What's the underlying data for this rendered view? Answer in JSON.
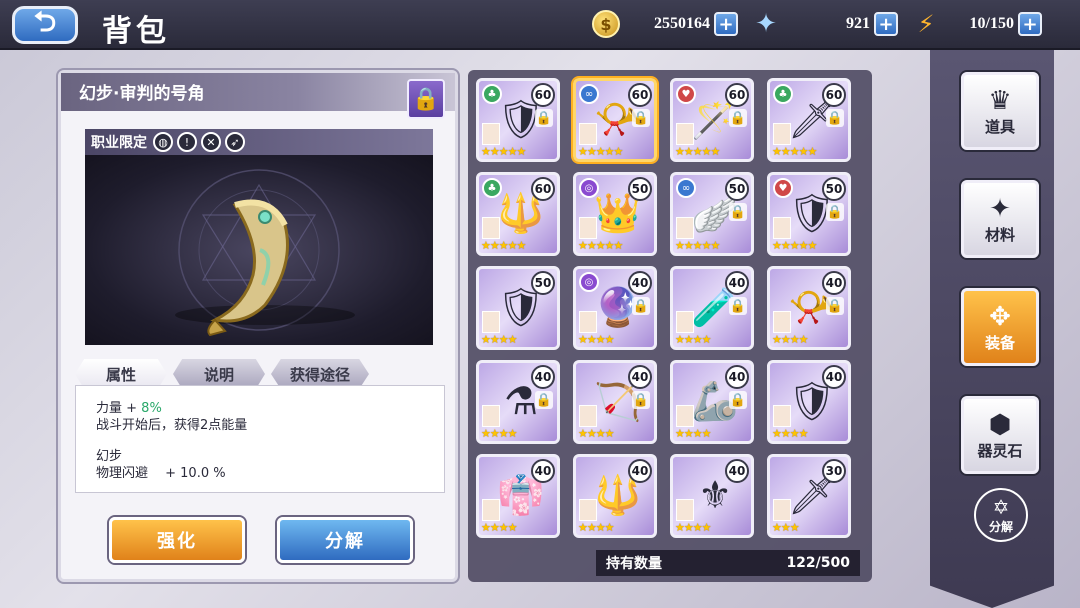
{
  "header": {
    "back_icon": "back-arrow-icon",
    "title": "背包",
    "gold": "2550164",
    "gems": "921",
    "stamina": "10/150"
  },
  "detail": {
    "item_name": "幻步·审判的号角",
    "class_restriction_label": "职业限定",
    "class_icons": [
      "shield-class-icon",
      "dagger-class-icon",
      "swords-class-icon",
      "bow-class-icon"
    ],
    "tabs": [
      "属性",
      "说明",
      "获得途径"
    ],
    "stat_line_1_prefix": "力量 + ",
    "stat_line_1_value": "8%",
    "stat_line_2": "战斗开始后，获得2点能量",
    "set_name": "幻步",
    "stat_line_3": "物理闪避 　+ 10.0 %",
    "enhance_label": "强化",
    "decompose_label": "分解"
  },
  "inventory": {
    "items": [
      {
        "level": "60",
        "stars": "★★★★★",
        "icon": "dark-armor-icon",
        "art": "🛡",
        "locked": true,
        "selected": false,
        "elem": "green"
      },
      {
        "level": "60",
        "stars": "★★★★★",
        "icon": "horn-icon",
        "art": "📯",
        "locked": true,
        "selected": true,
        "elem": "blue"
      },
      {
        "level": "60",
        "stars": "★★★★★",
        "icon": "staff-icon",
        "art": "🪄",
        "locked": true,
        "selected": false,
        "elem": "red"
      },
      {
        "level": "60",
        "stars": "★★★★★",
        "icon": "red-sword-icon",
        "art": "🗡",
        "locked": true,
        "selected": false,
        "elem": "green"
      },
      {
        "level": "60",
        "stars": "★★★★★",
        "icon": "scepter-icon",
        "art": "🔱",
        "locked": false,
        "selected": false,
        "elem": "green"
      },
      {
        "level": "50",
        "stars": "★★★★★",
        "icon": "crown-cushion-icon",
        "art": "👑",
        "locked": false,
        "selected": false,
        "elem": "purple"
      },
      {
        "level": "50",
        "stars": "★★★★★",
        "icon": "winged-boots-icon",
        "art": "🪽",
        "locked": true,
        "selected": false,
        "elem": "blue"
      },
      {
        "level": "50",
        "stars": "★★★★★",
        "icon": "round-shield-icon",
        "art": "🛡",
        "locked": true,
        "selected": false,
        "elem": "red"
      },
      {
        "level": "50",
        "stars": "★★★★",
        "icon": "knight-armor-icon",
        "art": "🛡",
        "locked": false,
        "selected": false,
        "elem": "none"
      },
      {
        "level": "40",
        "stars": "★★★★",
        "icon": "orb-staff-icon",
        "art": "🔮",
        "locked": true,
        "selected": false,
        "elem": "purple"
      },
      {
        "level": "40",
        "stars": "★★★★",
        "icon": "red-potion-icon",
        "art": "🧪",
        "locked": true,
        "selected": false,
        "elem": "none"
      },
      {
        "level": "40",
        "stars": "★★★★",
        "icon": "white-horn-icon",
        "art": "📯",
        "locked": true,
        "selected": false,
        "elem": "none"
      },
      {
        "level": "40",
        "stars": "★★★★",
        "icon": "blue-flask-icon",
        "art": "⚗",
        "locked": true,
        "selected": false,
        "elem": "none"
      },
      {
        "level": "40",
        "stars": "★★★★",
        "icon": "crossbow-icon",
        "art": "🏹",
        "locked": true,
        "selected": false,
        "elem": "none"
      },
      {
        "level": "40",
        "stars": "★★★★",
        "icon": "claw-armor-icon",
        "art": "🦾",
        "locked": true,
        "selected": false,
        "elem": "none"
      },
      {
        "level": "40",
        "stars": "★★★★",
        "icon": "silver-armor-icon",
        "art": "🛡",
        "locked": false,
        "selected": false,
        "elem": "none"
      },
      {
        "level": "40",
        "stars": "★★★★",
        "icon": "red-robe-icon",
        "art": "👘",
        "locked": false,
        "selected": false,
        "elem": "none"
      },
      {
        "level": "40",
        "stars": "★★★★",
        "icon": "blue-spear-icon",
        "art": "🔱",
        "locked": false,
        "selected": false,
        "elem": "none"
      },
      {
        "level": "40",
        "stars": "★★★★",
        "icon": "golden-scepter-icon",
        "art": "⚜",
        "locked": false,
        "selected": false,
        "elem": "none"
      },
      {
        "level": "30",
        "stars": "★★★",
        "icon": "dark-spear-icon",
        "art": "🗡",
        "locked": false,
        "selected": false,
        "elem": "none"
      }
    ],
    "count_label": "持有数量",
    "count_value": "122/500"
  },
  "sidebar": {
    "items": [
      {
        "label": "道具",
        "icon": "crown-emblem-icon",
        "glyph": "♛",
        "active": false
      },
      {
        "label": "材料",
        "icon": "crystal-icon",
        "glyph": "✦",
        "active": false
      },
      {
        "label": "装备",
        "icon": "armor-icon",
        "glyph": "✥",
        "active": true
      },
      {
        "label": "器灵石",
        "icon": "spirit-stone-icon",
        "glyph": "⬢",
        "active": false
      }
    ],
    "decompose_label": "分解",
    "decompose_icon": "pentagram-icon"
  }
}
